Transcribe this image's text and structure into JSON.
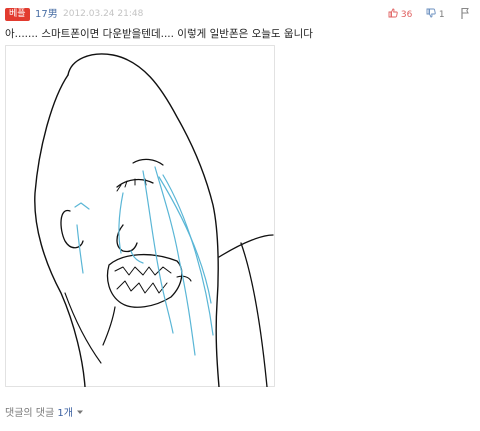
{
  "post": {
    "badge": "베플",
    "user": "17男",
    "timestamp": "2012.03.24 21:48",
    "upvotes": "36",
    "downvotes": "1",
    "text": "아....... 스마트폰이면 다운받을텐데.... 이렇게 일반폰은 오늘도 웁니다"
  },
  "comments": {
    "label_prefix": "댓글의 댓글 ",
    "count": "1개"
  },
  "colors": {
    "badge_bg": "#e23b2f",
    "tears": "#5ab6d6",
    "upvote": "#e06060"
  },
  "icons": {
    "upvote": "thumbs-up-icon",
    "downvote": "thumbs-down-icon",
    "report": "report-icon",
    "expand": "chevron-down-icon"
  }
}
